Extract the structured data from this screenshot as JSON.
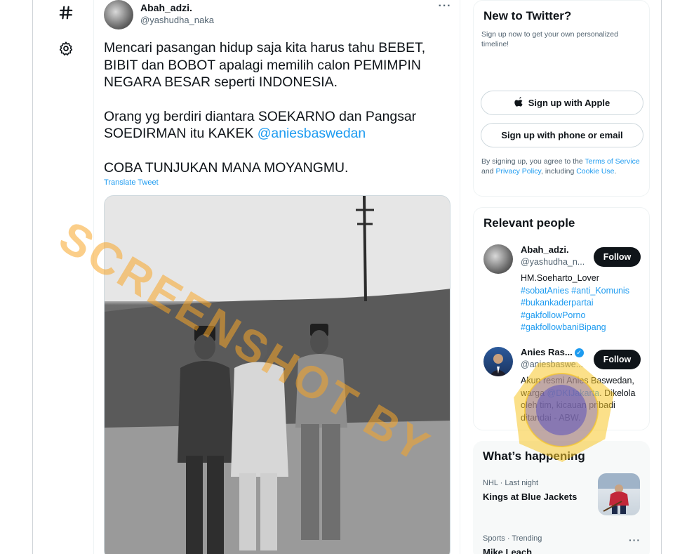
{
  "nav": {
    "explore_icon": "hashtag-icon",
    "settings_icon": "gear-icon"
  },
  "tweet": {
    "author_name": "Abah_adzi.",
    "author_handle": "@yashudha_naka",
    "more_label": "···",
    "paragraph1": "Mencari pasangan hidup saja kita harus tahu BEBET, BIBIT dan BOBOT apalagi memilih calon PEMIMPIN NEGARA BESAR seperti INDONESIA.",
    "paragraph2_prefix": "Orang yg berdiri diantara SOEKARNO dan Pangsar SOEDIRMAN  itu KAKEK ",
    "mention": "@aniesbaswedan",
    "paragraph3": "COBA TUNJUKAN MANA MOYANGMU.",
    "translate_label": "Translate Tweet"
  },
  "watermark": {
    "text": "SCREENSHOT BY"
  },
  "signup_card": {
    "title": "New to Twitter?",
    "subtitle": "Sign up now to get your own personalized timeline!",
    "apple_button": "Sign up with Apple",
    "phone_button": "Sign up with phone or email",
    "legal_prefix": "By signing up, you agree to the ",
    "terms_link": "Terms of Service",
    "legal_and": " and ",
    "privacy_link": "Privacy Policy",
    "legal_including": ", including ",
    "cookie_link": "Cookie Use",
    "legal_end": "."
  },
  "relevant_people": {
    "title": "Relevant people",
    "people": [
      {
        "name": "Abah_adzi.",
        "handle": "@yashudha_n...",
        "follow_label": "Follow",
        "bio_text": "HM.Soeharto_Lover",
        "bio_tags": "#sobatAnies #anti_Komunis #bukankaderpartai #gakfollowPorno #gakfollowbaniBipang"
      },
      {
        "name": "Anies Ras...",
        "handle": "@aniesbaswe...",
        "follow_label": "Follow",
        "bio_prefix": "Akun resmi Anies Baswedan, warga ",
        "bio_mention": "@DKIJakarta",
        "bio_suffix": ". Dikelola oleh tim, kicauan pribadi ditandai - ABW."
      }
    ]
  },
  "happening": {
    "title": "What’s happening",
    "trends": [
      {
        "meta": "NHL · Last night",
        "title": "Kings at Blue Jackets"
      },
      {
        "meta": "Sports · Trending",
        "title": "Mike Leach",
        "more": "···"
      }
    ]
  },
  "colors": {
    "accent": "#1d9bf0",
    "text": "#0f1419",
    "secondary": "#536471",
    "watermark": "#f7a628"
  }
}
